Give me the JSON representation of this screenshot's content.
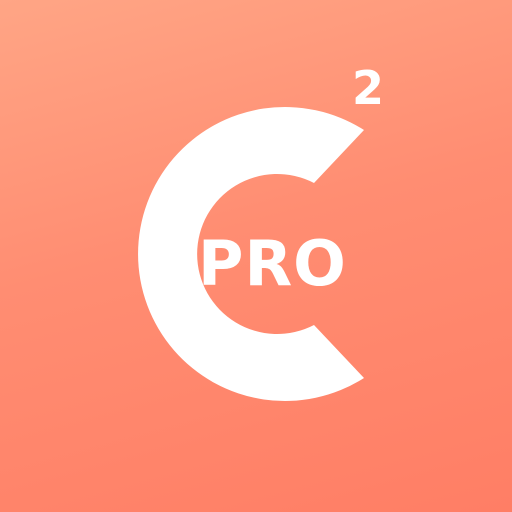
{
  "logo": {
    "badge_text": "PRO",
    "superscript": "2",
    "background_colors": [
      "#ffa585",
      "#ff7e65"
    ],
    "glyph_color": "#ffffff",
    "icon": "letter-c-glyph"
  }
}
